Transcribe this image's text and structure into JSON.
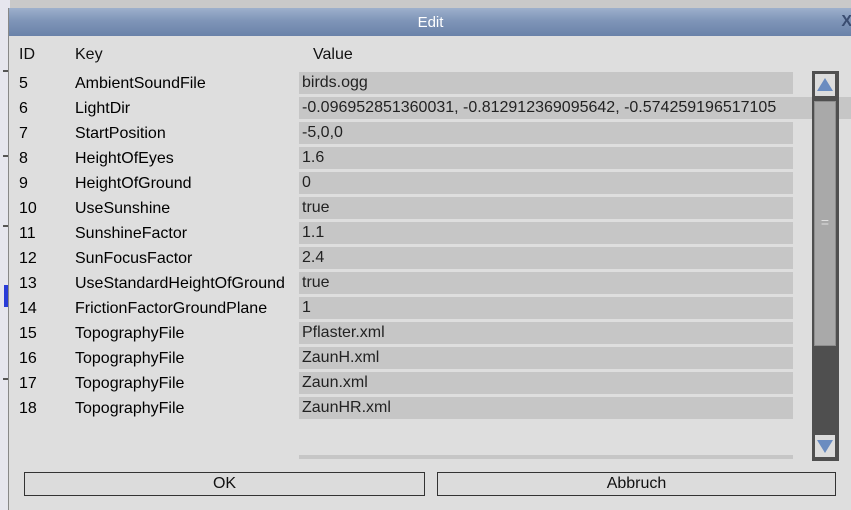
{
  "dialog": {
    "title": "Edit",
    "close_glyph": "X"
  },
  "columns": {
    "id": "ID",
    "key": "Key",
    "value": "Value"
  },
  "rows": [
    {
      "id": "5",
      "key": "AmbientSoundFile",
      "value": "birds.ogg"
    },
    {
      "id": "6",
      "key": "LightDir",
      "value": "-0.096952851360031,  -0.812912369095642,  -0.574259196517105"
    },
    {
      "id": "7",
      "key": "StartPosition",
      "value": "-5,0,0"
    },
    {
      "id": "8",
      "key": "HeightOfEyes",
      "value": "1.6"
    },
    {
      "id": "9",
      "key": "HeightOfGround",
      "value": "0"
    },
    {
      "id": "10",
      "key": "UseSunshine",
      "value": "true"
    },
    {
      "id": "11",
      "key": "SunshineFactor",
      "value": "1.1"
    },
    {
      "id": "12",
      "key": "SunFocusFactor",
      "value": "2.4"
    },
    {
      "id": "13",
      "key": "UseStandardHeightOfGround",
      "value": "true"
    },
    {
      "id": "14",
      "key": "FrictionFactorGroundPlane",
      "value": "1"
    },
    {
      "id": "15",
      "key": "TopographyFile",
      "value": "Pflaster.xml"
    },
    {
      "id": "16",
      "key": "TopographyFile",
      "value": "ZaunH.xml"
    },
    {
      "id": "17",
      "key": "TopographyFile",
      "value": "Zaun.xml"
    },
    {
      "id": "18",
      "key": "TopographyFile",
      "value": "ZaunHR.xml"
    }
  ],
  "scrollbar": {
    "grip_glyph": "=",
    "up_icon": "triangle-up-icon",
    "down_icon": "triangle-down-icon",
    "thumb_color": "#a9a9a9",
    "arrow_color": "#6a8cc0"
  },
  "buttons": {
    "ok": "OK",
    "cancel": "Abbruch"
  },
  "colors": {
    "titlebar": "#7f95b8",
    "window_bg": "#dedede",
    "value_bg": "#c6c6c6"
  }
}
